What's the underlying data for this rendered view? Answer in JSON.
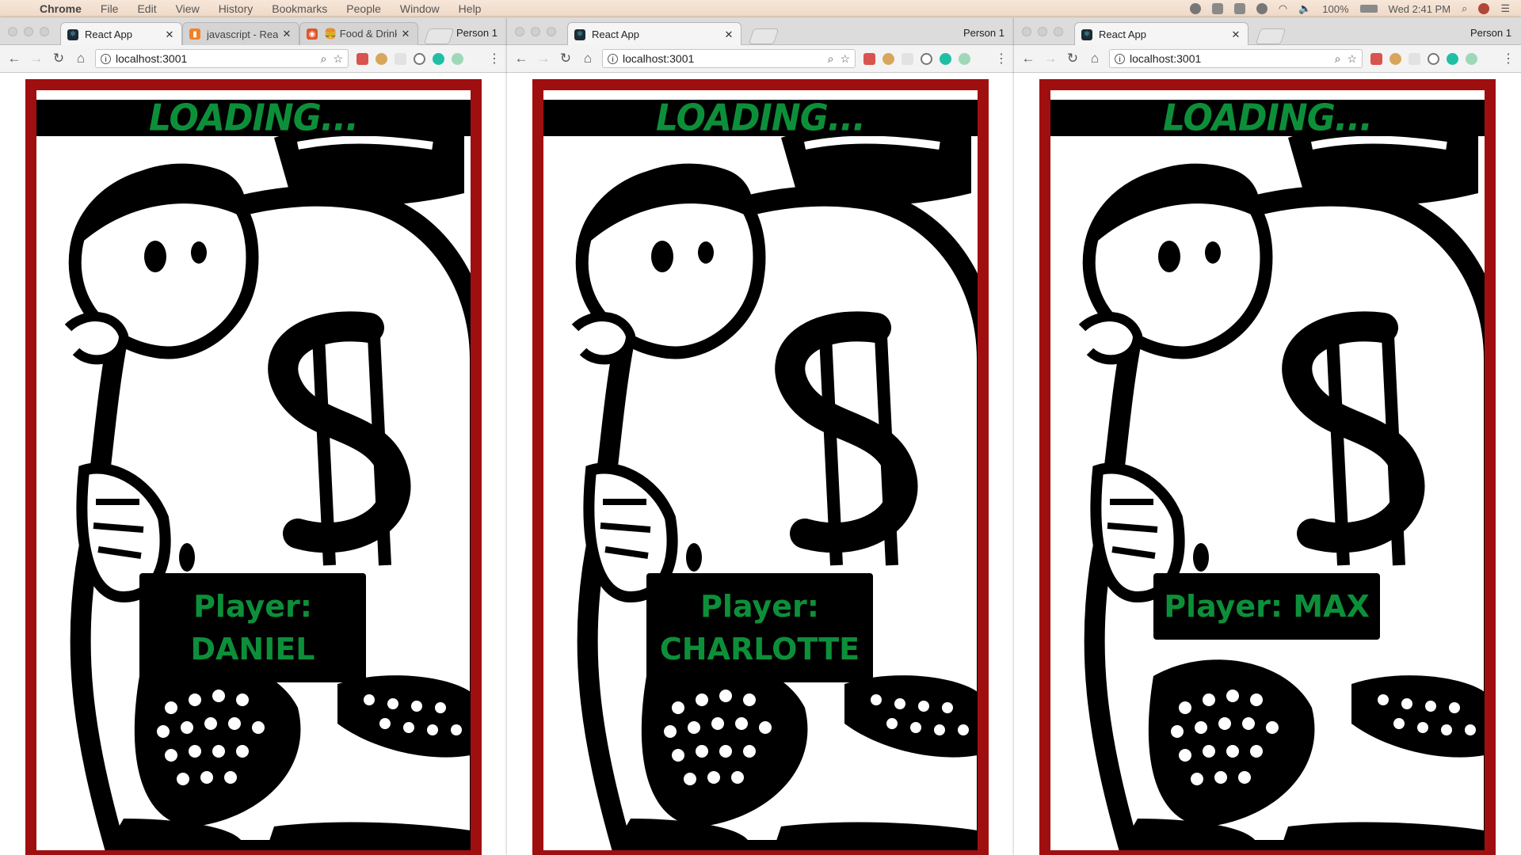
{
  "menubar": {
    "app_name": "Chrome",
    "items": [
      "File",
      "Edit",
      "View",
      "History",
      "Bookmarks",
      "People",
      "Window",
      "Help"
    ],
    "battery": "100%",
    "clock": "Wed 2:41 PM"
  },
  "windows": [
    {
      "tabs": [
        {
          "label": "React App",
          "favicon": "react-icon",
          "active": true
        },
        {
          "label": "javascript - React",
          "favicon": "stackoverflow-icon",
          "active": false
        },
        {
          "label": "🍔 Food & Drink",
          "favicon": "food-icon",
          "active": false
        }
      ],
      "profile": "Person 1",
      "url": "localhost:3001",
      "page": {
        "banner": "LOADING...",
        "player_label": "Player:",
        "player_name": "DANIEL"
      }
    },
    {
      "tabs": [
        {
          "label": "React App",
          "favicon": "react-icon",
          "active": true
        }
      ],
      "profile": "Person 1",
      "url": "localhost:3001",
      "page": {
        "banner": "LOADING...",
        "player_label": "Player:",
        "player_name": "CHARLOTTE"
      }
    },
    {
      "tabs": [
        {
          "label": "React App",
          "favicon": "react-icon",
          "active": true
        }
      ],
      "profile": "Person 1",
      "url": "localhost:3001",
      "page": {
        "banner": "LOADING...",
        "player_label": "Player: MAX",
        "player_name": ""
      }
    }
  ],
  "colors": {
    "frame_red": "#a00f10",
    "text_green": "#0d8f3a",
    "banner_black": "#000000"
  }
}
